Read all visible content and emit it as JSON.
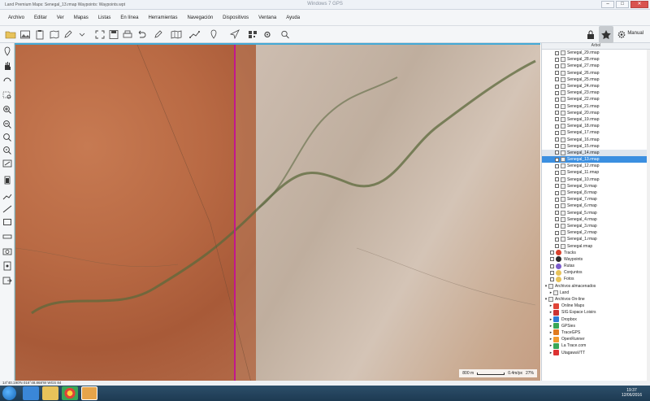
{
  "window": {
    "title": "Windows 7 GPS",
    "document": "Land Premium Maps: Senegal_13.rmap Waypoints: Waypoints.wpt",
    "buttons": [
      "–",
      "□",
      "✕"
    ]
  },
  "menu": [
    "Archivo",
    "Editar",
    "Ver",
    "Mapas",
    "Listas",
    "En línea",
    "Herramientas",
    "Navegación",
    "Dispositivos",
    "Ventana",
    "Ayuda"
  ],
  "toolbar": {
    "manual_label": "Manual"
  },
  "panel": {
    "header": "Árbol",
    "maps": [
      "Senegal_29.rmap",
      "Senegal_28.rmap",
      "Senegal_27.rmap",
      "Senegal_26.rmap",
      "Senegal_25.rmap",
      "Senegal_24.rmap",
      "Senegal_23.rmap",
      "Senegal_22.rmap",
      "Senegal_21.rmap",
      "Senegal_20.rmap",
      "Senegal_19.rmap",
      "Senegal_18.rmap",
      "Senegal_17.rmap",
      "Senegal_16.rmap",
      "Senegal_15.rmap",
      "Senegal_14.rmap",
      "Senegal_13.rmap",
      "Senegal_12.rmap",
      "Senegal_11.rmap",
      "Senegal_10.rmap",
      "Senegal_9.rmap",
      "Senegal_8.rmap",
      "Senegal_7.rmap",
      "Senegal_6.rmap",
      "Senegal_5.rmap",
      "Senegal_4.rmap",
      "Senegal_3.rmap",
      "Senegal_2.rmap",
      "Senegal_1.rmap",
      "Senegal.rmap"
    ],
    "selected_map": "Senegal_13.rmap",
    "layers": [
      "Tracks",
      "Waypoints",
      "Rutas",
      "Conjuntos",
      "Fotos"
    ],
    "stored_header": "Archivos almacenados",
    "stored": [
      "Land"
    ],
    "online_header": "Archivos On-line",
    "online": [
      "Online Maps",
      "SIG Espace Loisirs",
      "Dropbox",
      "GPSies",
      "TraceGPS",
      "OpenRunner",
      "La Trace.com",
      "UtagawaVTT"
    ]
  },
  "map": {
    "scale_label": "800 m",
    "zoom": "27%",
    "scale_info": "0.4m/px"
  },
  "status": {
    "coordinates": "14°40.190'N 016°48.868'W  WGS 84"
  },
  "clock": {
    "time": "19:37",
    "date": "12/06/2016"
  },
  "colors": {
    "accent": "#3b8fe0",
    "map_frame": "#44a9d6",
    "selection_line": "#c2178e"
  }
}
